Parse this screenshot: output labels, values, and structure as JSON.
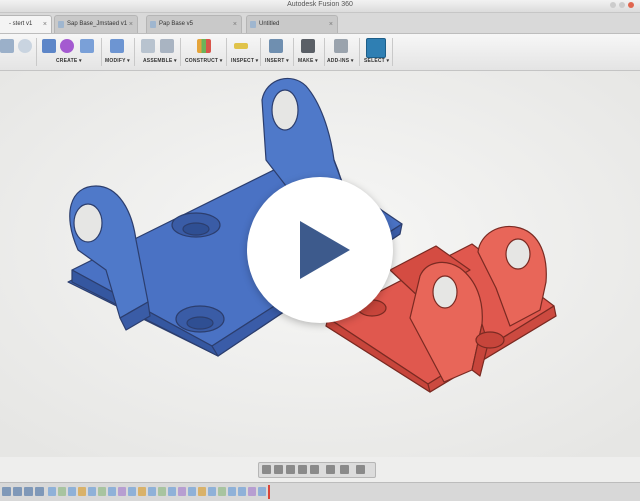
{
  "app": {
    "window_title": "Autodesk Fusion 360"
  },
  "tabs": [
    {
      "label": "- stert v1",
      "active": true
    },
    {
      "label": "Sap Base_Jmstaed v1",
      "active": false
    },
    {
      "label": "Pap Base v5",
      "active": false
    },
    {
      "label": "Untitled",
      "active": false
    }
  ],
  "toolbar": {
    "groups": [
      {
        "label": "CREATE ▾"
      },
      {
        "label": "MODIFY ▾"
      },
      {
        "label": "ASSEMBLE ▾"
      },
      {
        "label": "CONSTRUCT ▾"
      },
      {
        "label": "INSPECT ▾"
      },
      {
        "label": "INSERT ▾"
      },
      {
        "label": "MAKE ▾"
      },
      {
        "label": "ADD-INS ▾"
      },
      {
        "label": "SELECT ▾"
      }
    ]
  },
  "viewport": {
    "parts": [
      {
        "name": "blue-bracket",
        "color": "#4a72c4"
      },
      {
        "name": "red-bracket",
        "color": "#e0584e"
      }
    ],
    "background": "#eeeeed"
  },
  "overlay": {
    "play_button": "play-icon",
    "accent": "#3d5a8c"
  }
}
